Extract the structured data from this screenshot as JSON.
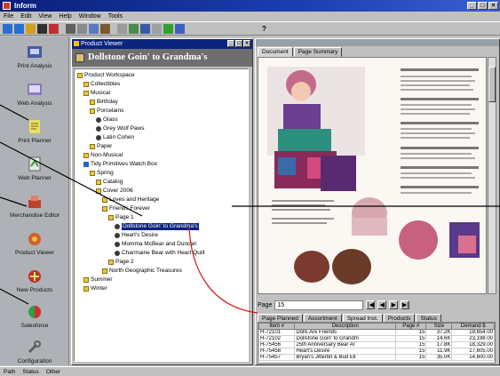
{
  "titlebar": {
    "title": "Inform"
  },
  "menus": [
    "File",
    "Edit",
    "View",
    "Help",
    "Window",
    "Tools"
  ],
  "left_panel": [
    {
      "label": "Print Analysis",
      "icon": "print-analysis-icon"
    },
    {
      "label": "Web Analysis",
      "icon": "web-analysis-icon"
    },
    {
      "label": "Print Planner",
      "icon": "print-planner-icon"
    },
    {
      "label": "Web Planner",
      "icon": "web-planner-icon"
    },
    {
      "label": "Merchandise Editor",
      "icon": "merchandise-editor-icon"
    },
    {
      "label": "Product Viewer",
      "icon": "product-viewer-icon"
    },
    {
      "label": "New Products",
      "icon": "new-products-icon"
    },
    {
      "label": "Salesforce",
      "icon": "salesforce-icon"
    },
    {
      "label": "Configuration",
      "icon": "configuration-icon"
    }
  ],
  "product_viewer": {
    "window_title": "Product Viewer",
    "header": "Dollstone Goin' to Grandma's",
    "tree": [
      {
        "label": "Product Workspace",
        "depth": 0,
        "icon": "folder"
      },
      {
        "label": "Collectibles",
        "depth": 1,
        "icon": "folder"
      },
      {
        "label": "Musical",
        "depth": 1,
        "icon": "folder"
      },
      {
        "label": "Birthday",
        "depth": 2,
        "icon": "folder"
      },
      {
        "label": "Porcelains",
        "depth": 2,
        "icon": "folder"
      },
      {
        "label": "Glass",
        "depth": 3,
        "icon": "doc"
      },
      {
        "label": "Grey Wolf Paws",
        "depth": 3,
        "icon": "doc"
      },
      {
        "label": "Latin Cohen",
        "depth": 3,
        "icon": "doc"
      },
      {
        "label": "Paper",
        "depth": 2,
        "icon": "folder"
      },
      {
        "label": "Non-Musical",
        "depth": 1,
        "icon": "folder"
      },
      {
        "label": "Tidy Primitives Watch Box",
        "depth": 1,
        "icon": "book"
      },
      {
        "label": "Spring",
        "depth": 2,
        "icon": "folder"
      },
      {
        "label": "Catalog",
        "depth": 3,
        "icon": "folder"
      },
      {
        "label": "Cover 2006",
        "depth": 3,
        "icon": "folder"
      },
      {
        "label": "Loves and Heritage",
        "depth": 4,
        "icon": "folder"
      },
      {
        "label": "Friends Forever",
        "depth": 4,
        "icon": "folder"
      },
      {
        "label": "Page 1",
        "depth": 5,
        "icon": "folder"
      },
      {
        "label": "Dollstone Goin' to Grandma's",
        "depth": 6,
        "icon": "doc",
        "selected": true
      },
      {
        "label": "Heart's Desire",
        "depth": 6,
        "icon": "doc"
      },
      {
        "label": "Momma McBear and Duncan",
        "depth": 6,
        "icon": "doc"
      },
      {
        "label": "Charmaine Bear with Heart Quilt",
        "depth": 6,
        "icon": "doc"
      },
      {
        "label": "Page 2",
        "depth": 5,
        "icon": "folder"
      },
      {
        "label": "North Geographic Treasures",
        "depth": 4,
        "icon": "folder"
      },
      {
        "label": "Summer",
        "depth": 1,
        "icon": "folder"
      },
      {
        "label": "Winter",
        "depth": 1,
        "icon": "folder"
      }
    ]
  },
  "right_window": {
    "tabs": [
      "Document",
      "Page Summary"
    ],
    "active_tab": "Document",
    "page_label": "Page",
    "page_value": "15",
    "nav_buttons": [
      "|◀",
      "◀",
      "▶",
      "▶|"
    ],
    "lower_tabs": [
      "Page Planned",
      "Assortment",
      "Spread Inst.",
      "Products",
      "Status"
    ],
    "lower_active_tab": "Spread Inst.",
    "table": {
      "columns": [
        "Item #",
        "Description",
        "Page #",
        "Size",
        "Demand $"
      ],
      "rows": [
        [
          "H-72101",
          "Dolls Are Friends",
          "15",
          "37.2K",
          "18,654.00"
        ],
        [
          "H-72102",
          "Dollstone Goin' to Grandm",
          "15",
          "14.6K",
          "23,198.00"
        ],
        [
          "H-75456",
          "25th Anniversary Bear Ar",
          "15",
          "17.8K",
          "18,329.00"
        ],
        [
          "H-75458",
          "Heart's Desire",
          "15",
          "11.9K",
          "17,605.00"
        ],
        [
          "H-75457",
          "Bryan's Jitterbit & Bud Ell",
          "15",
          "35.0K",
          "14,600.00"
        ]
      ]
    }
  },
  "statusbar": [
    "Path",
    "Status",
    "Other"
  ]
}
